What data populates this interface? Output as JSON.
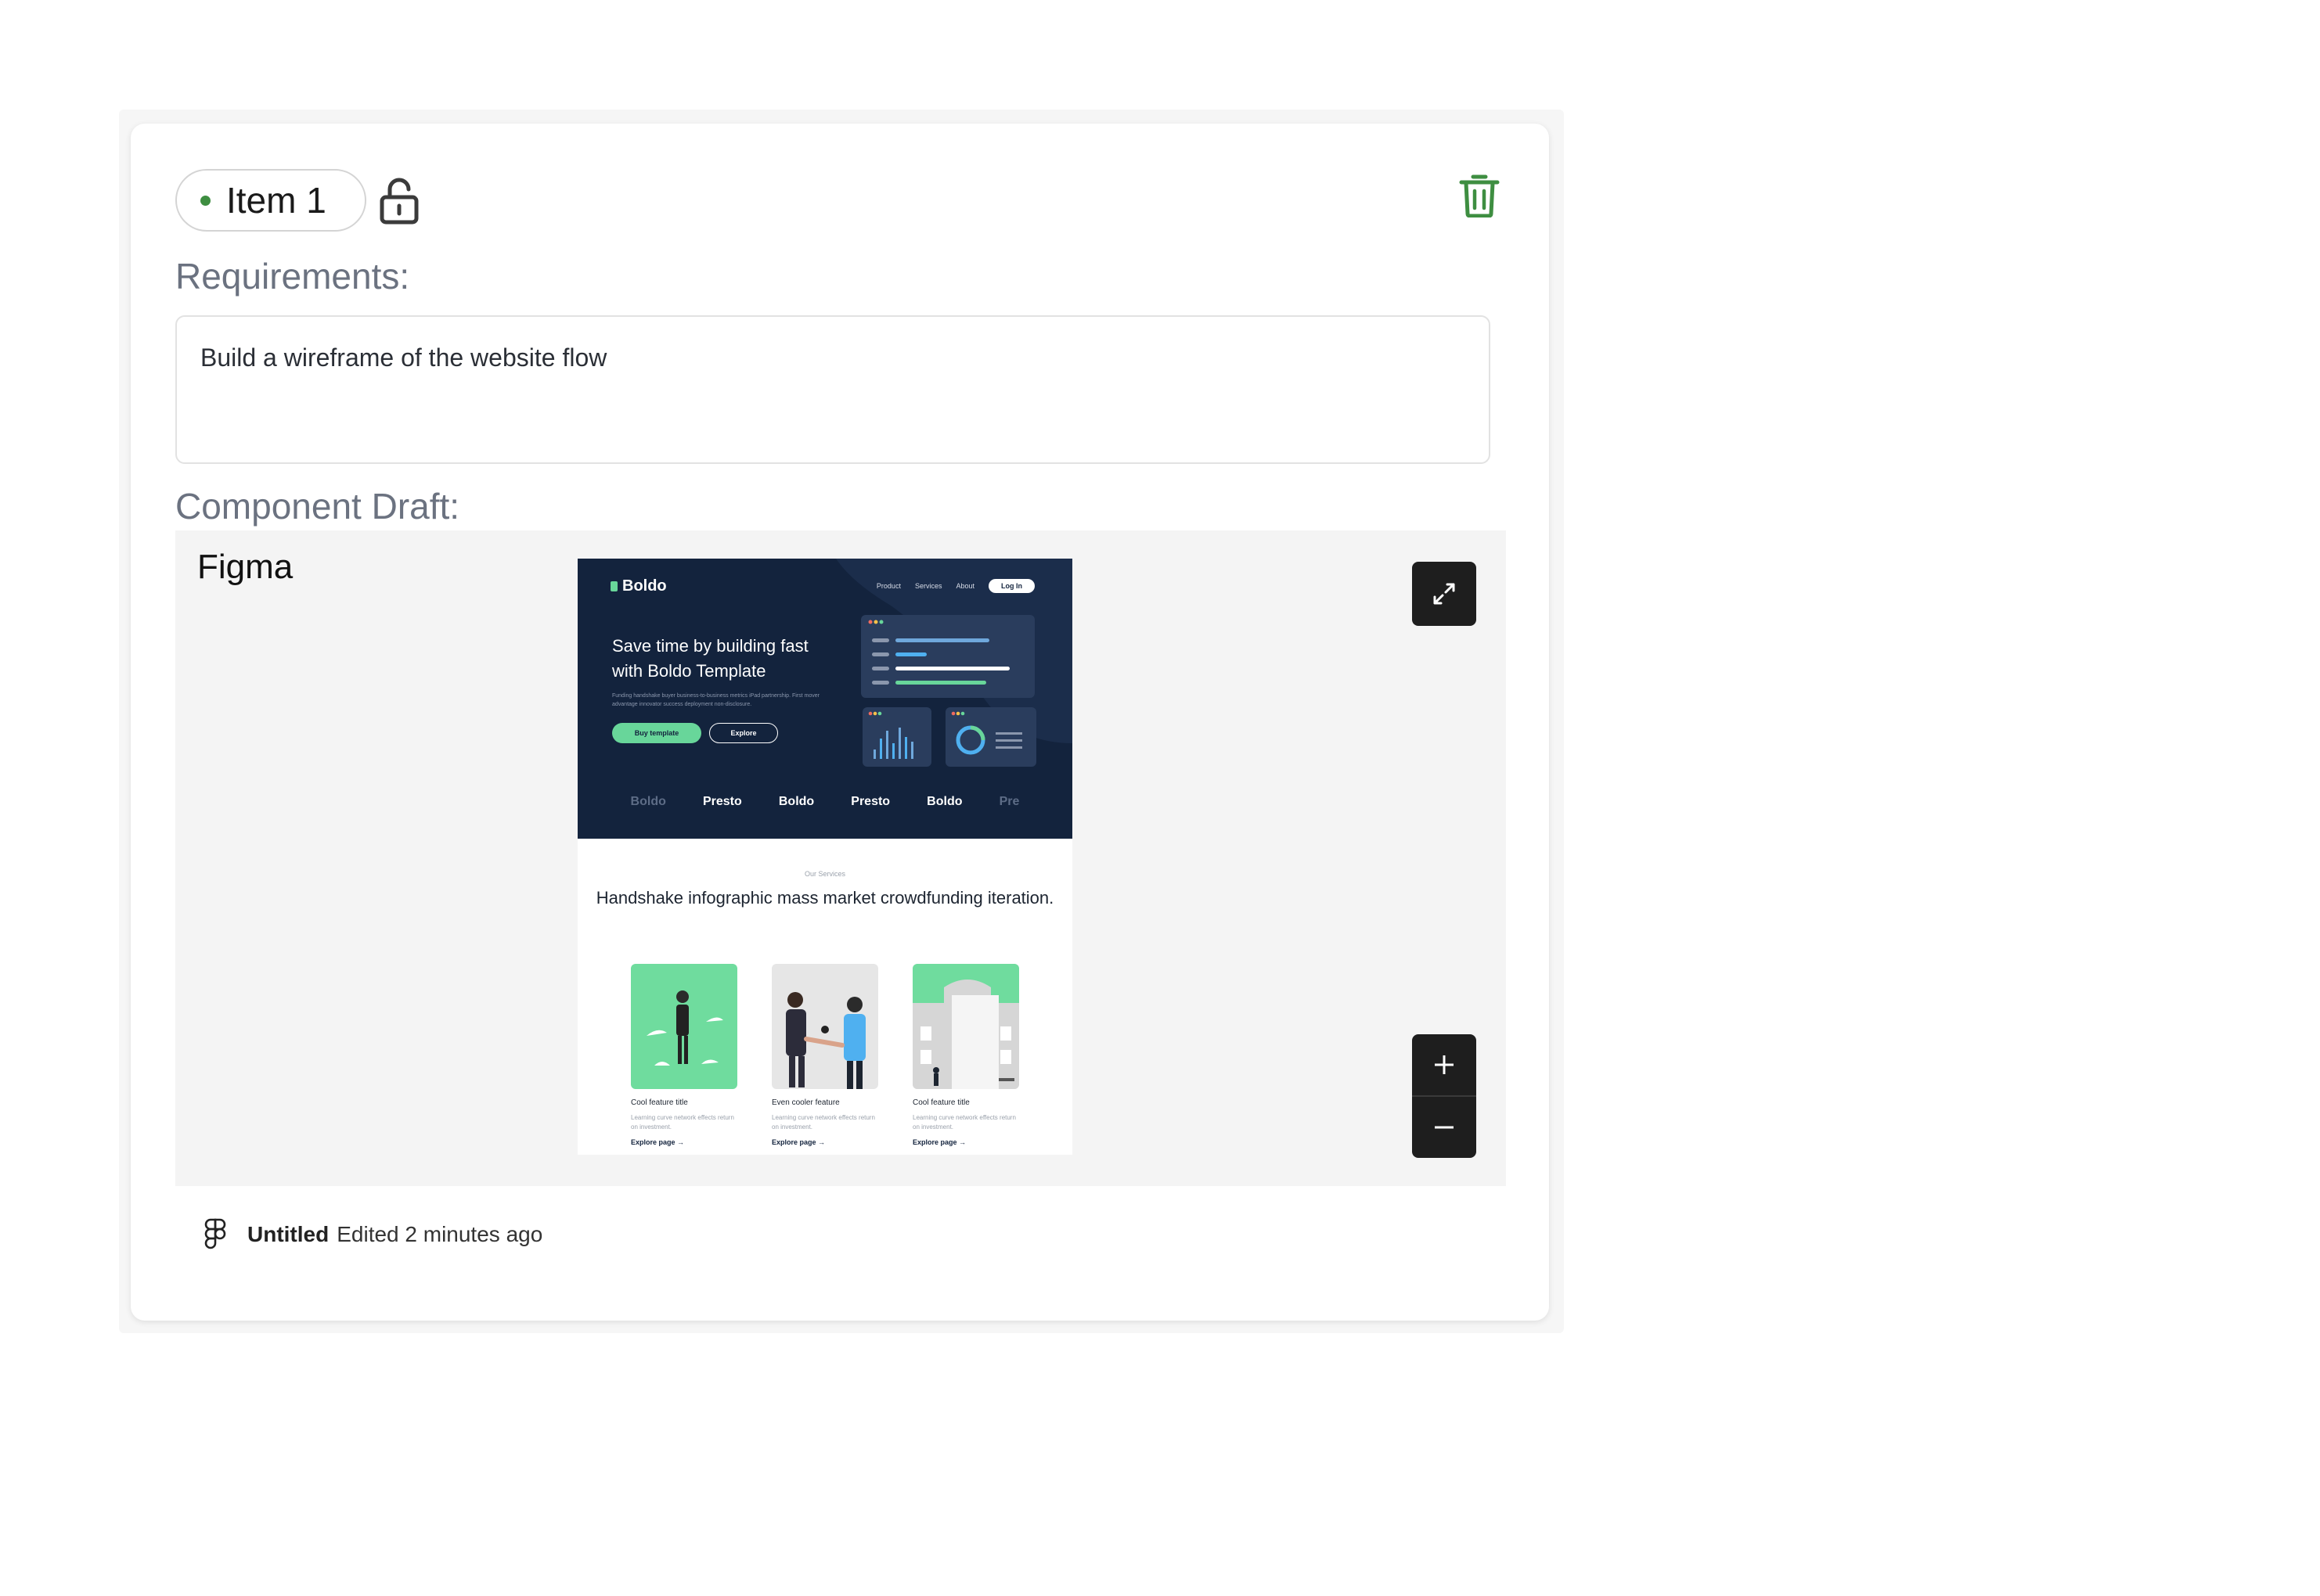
{
  "item": {
    "label": "Item 1",
    "status_color": "#3e8e41"
  },
  "requirements": {
    "label": "Requirements:",
    "text": "Build a wireframe of the website flow"
  },
  "component_draft": {
    "label": "Component Draft:",
    "embed_title": "Figma",
    "file_name": "Untitled",
    "edited": "Edited 2 minutes ago"
  },
  "preview": {
    "brand": "Boldo",
    "nav": [
      "Product",
      "Services",
      "About"
    ],
    "login": "Log In",
    "hero_title": "Save time by building fast with Boldo Template",
    "hero_sub": "Funding handshake buyer business-to-business metrics iPad partnership. First mover advantage innovator success deployment non-disclosure.",
    "buy_button": "Buy template",
    "explore_button": "Explore",
    "logos": [
      "Boldo",
      "Presto",
      "Boldo",
      "Presto",
      "Boldo",
      "Pre"
    ],
    "services_kicker": "Our Services",
    "services_title": "Handshake infographic mass market crowdfunding iteration.",
    "features": [
      {
        "title": "Cool feature title",
        "desc": "Learning curve network effects return on investment.",
        "link": "Explore page →"
      },
      {
        "title": "Even cooler feature",
        "desc": "Learning curve network effects return on investment.",
        "link": "Explore page →"
      },
      {
        "title": "Cool feature title",
        "desc": "Learning curve network effects return on investment.",
        "link": "Explore page →"
      }
    ]
  },
  "icons": {
    "lock": "unlock-icon",
    "trash": "trash-icon",
    "expand": "expand-icon",
    "zoom_in": "plus-icon",
    "zoom_out": "minus-icon",
    "figma": "figma-logo-icon"
  },
  "colors": {
    "accent": "#3e8e41",
    "label_gray": "#6b7280",
    "controls": "#1e1e1e"
  }
}
